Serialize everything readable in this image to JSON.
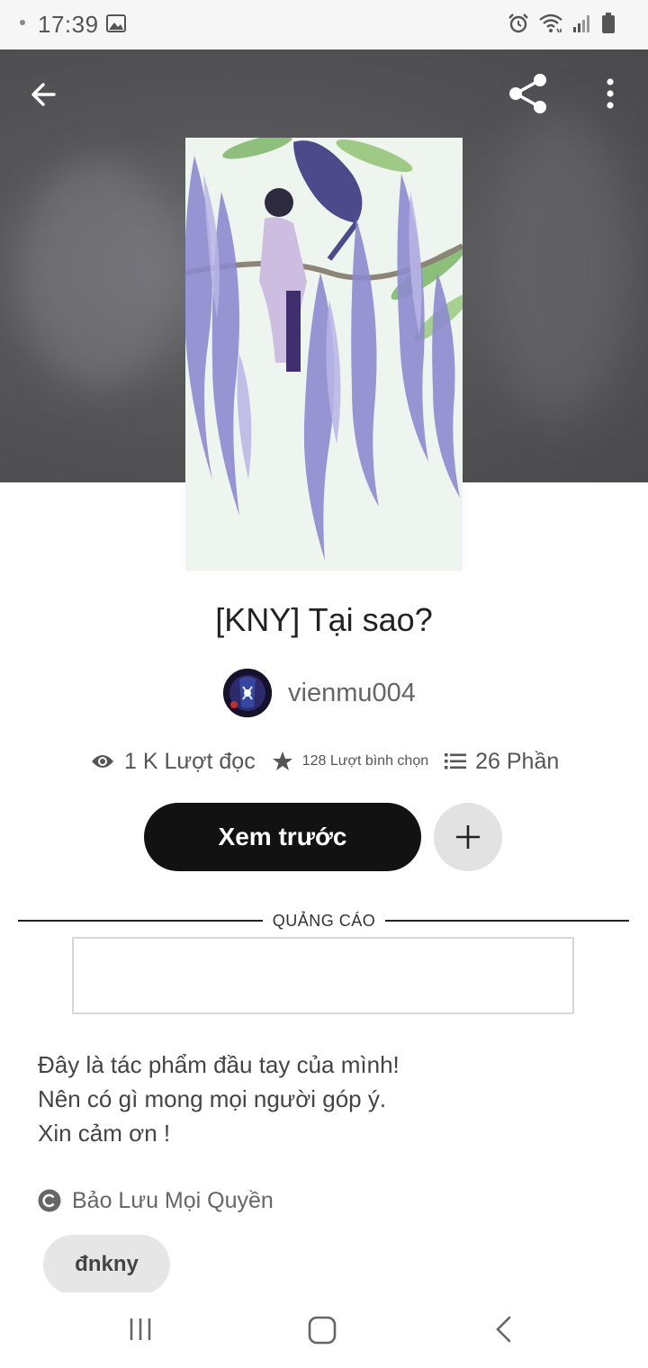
{
  "status_bar": {
    "time": "17:39",
    "icons": [
      "gallery-icon",
      "alarm-icon",
      "wifi-icon",
      "signal-icon",
      "battery-icon"
    ]
  },
  "toolbar": {
    "icons": [
      "back-arrow-icon",
      "share-icon",
      "more-vertical-icon"
    ]
  },
  "story": {
    "title": "[KNY] Tại sao?",
    "author": "vienmu004",
    "reads": "1 K Lượt đọc",
    "votes": "128 Lượt bình chọn",
    "parts": "26 Phần",
    "preview_button": "Xem trước",
    "description": [
      "Đây là tác phẩm đầu tay của mình!",
      "Nên có gì mong mọi người góp ý.",
      "Xin cảm ơn !"
    ],
    "copyright": "Bảo Lưu Mọi Quyền",
    "tags": [
      "đnkny"
    ]
  },
  "ad": {
    "label": "QUẢNG CÁO"
  },
  "nav_bar": {
    "icons": [
      "recent-apps-icon",
      "home-icon",
      "back-icon"
    ]
  },
  "colors": {
    "hero_bg": "#565659",
    "primary_button": "#121212",
    "secondary_button": "#e2e2e2",
    "tag_bg": "#e6e6e6"
  }
}
